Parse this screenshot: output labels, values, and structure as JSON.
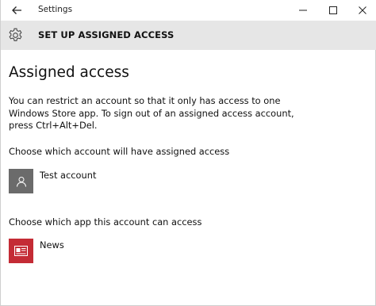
{
  "window": {
    "app_title": "Settings",
    "icons": {
      "back": "back-arrow-icon",
      "minimize": "minimize-icon",
      "maximize": "maximize-icon",
      "close": "close-icon"
    }
  },
  "header": {
    "icon": "gear-icon",
    "title": "SET UP ASSIGNED ACCESS"
  },
  "main": {
    "title": "Assigned access",
    "description": "You can restrict an account so that it only has access to one Windows Store app. To sign out of an assigned access account, press Ctrl+Alt+Del.",
    "account_section": {
      "label": "Choose which account will have assigned access",
      "account_name": "Test account",
      "icon": "user-icon"
    },
    "app_section": {
      "label": "Choose which app this account can access",
      "app_name": "News",
      "icon": "news-icon"
    }
  },
  "colors": {
    "header_bg": "#e6e6e6",
    "user_tile": "#6b6b6b",
    "news_tile": "#c42b35"
  }
}
